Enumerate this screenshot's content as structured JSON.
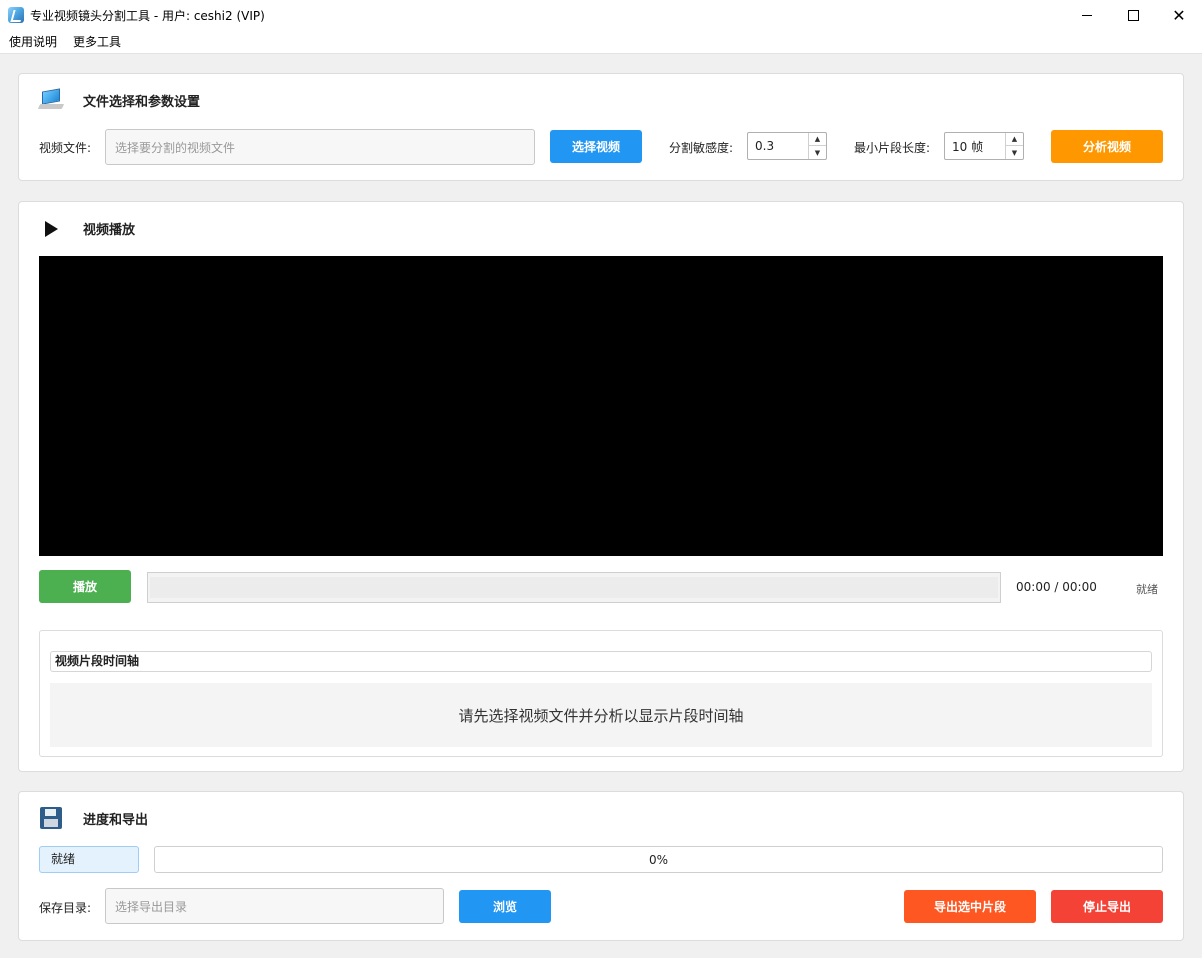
{
  "window": {
    "title": "专业视频镜头分割工具 - 用户: ceshi2 (VIP)",
    "minimize": "",
    "maximize": "",
    "close": "✕"
  },
  "menu": {
    "items": [
      "使用说明",
      "更多工具"
    ]
  },
  "file_panel": {
    "title": "文件选择和参数设置",
    "video_file_label": "视频文件:",
    "video_file_placeholder": "选择要分割的视频文件",
    "choose_video_button": "选择视频",
    "sensitivity_label": "分割敏感度:",
    "sensitivity_value": "0.3",
    "min_segment_label": "最小片段长度:",
    "min_segment_value": "10 帧",
    "analyze_button": "分析视频"
  },
  "player_panel": {
    "title": "视频播放",
    "play_button": "播放",
    "time_display": "00:00 / 00:00",
    "status": "就绪",
    "timeline_title": "视频片段时间轴",
    "timeline_empty_message": "请先选择视频文件并分析以显示片段时间轴"
  },
  "export_panel": {
    "title": "进度和导出",
    "status": "就绪",
    "progress_text": "0%",
    "progress_value": 0,
    "save_dir_label": "保存目录:",
    "save_dir_placeholder": "选择导出目录",
    "browse_button": "浏览",
    "export_selected_button": "导出选中片段",
    "stop_export_button": "停止导出"
  },
  "colors": {
    "blue_button": "#2196f3",
    "orange_button": "#ff9800",
    "green_button": "#4caf50",
    "deep_orange_button": "#ff5722",
    "red_button": "#f44336",
    "status_chip_bg": "#e3f2fd"
  },
  "icons": {
    "app": "video-cut-app-icon",
    "file_panel": "monitor-icon",
    "player_panel": "play-icon",
    "export_panel": "floppy-disk-icon"
  }
}
